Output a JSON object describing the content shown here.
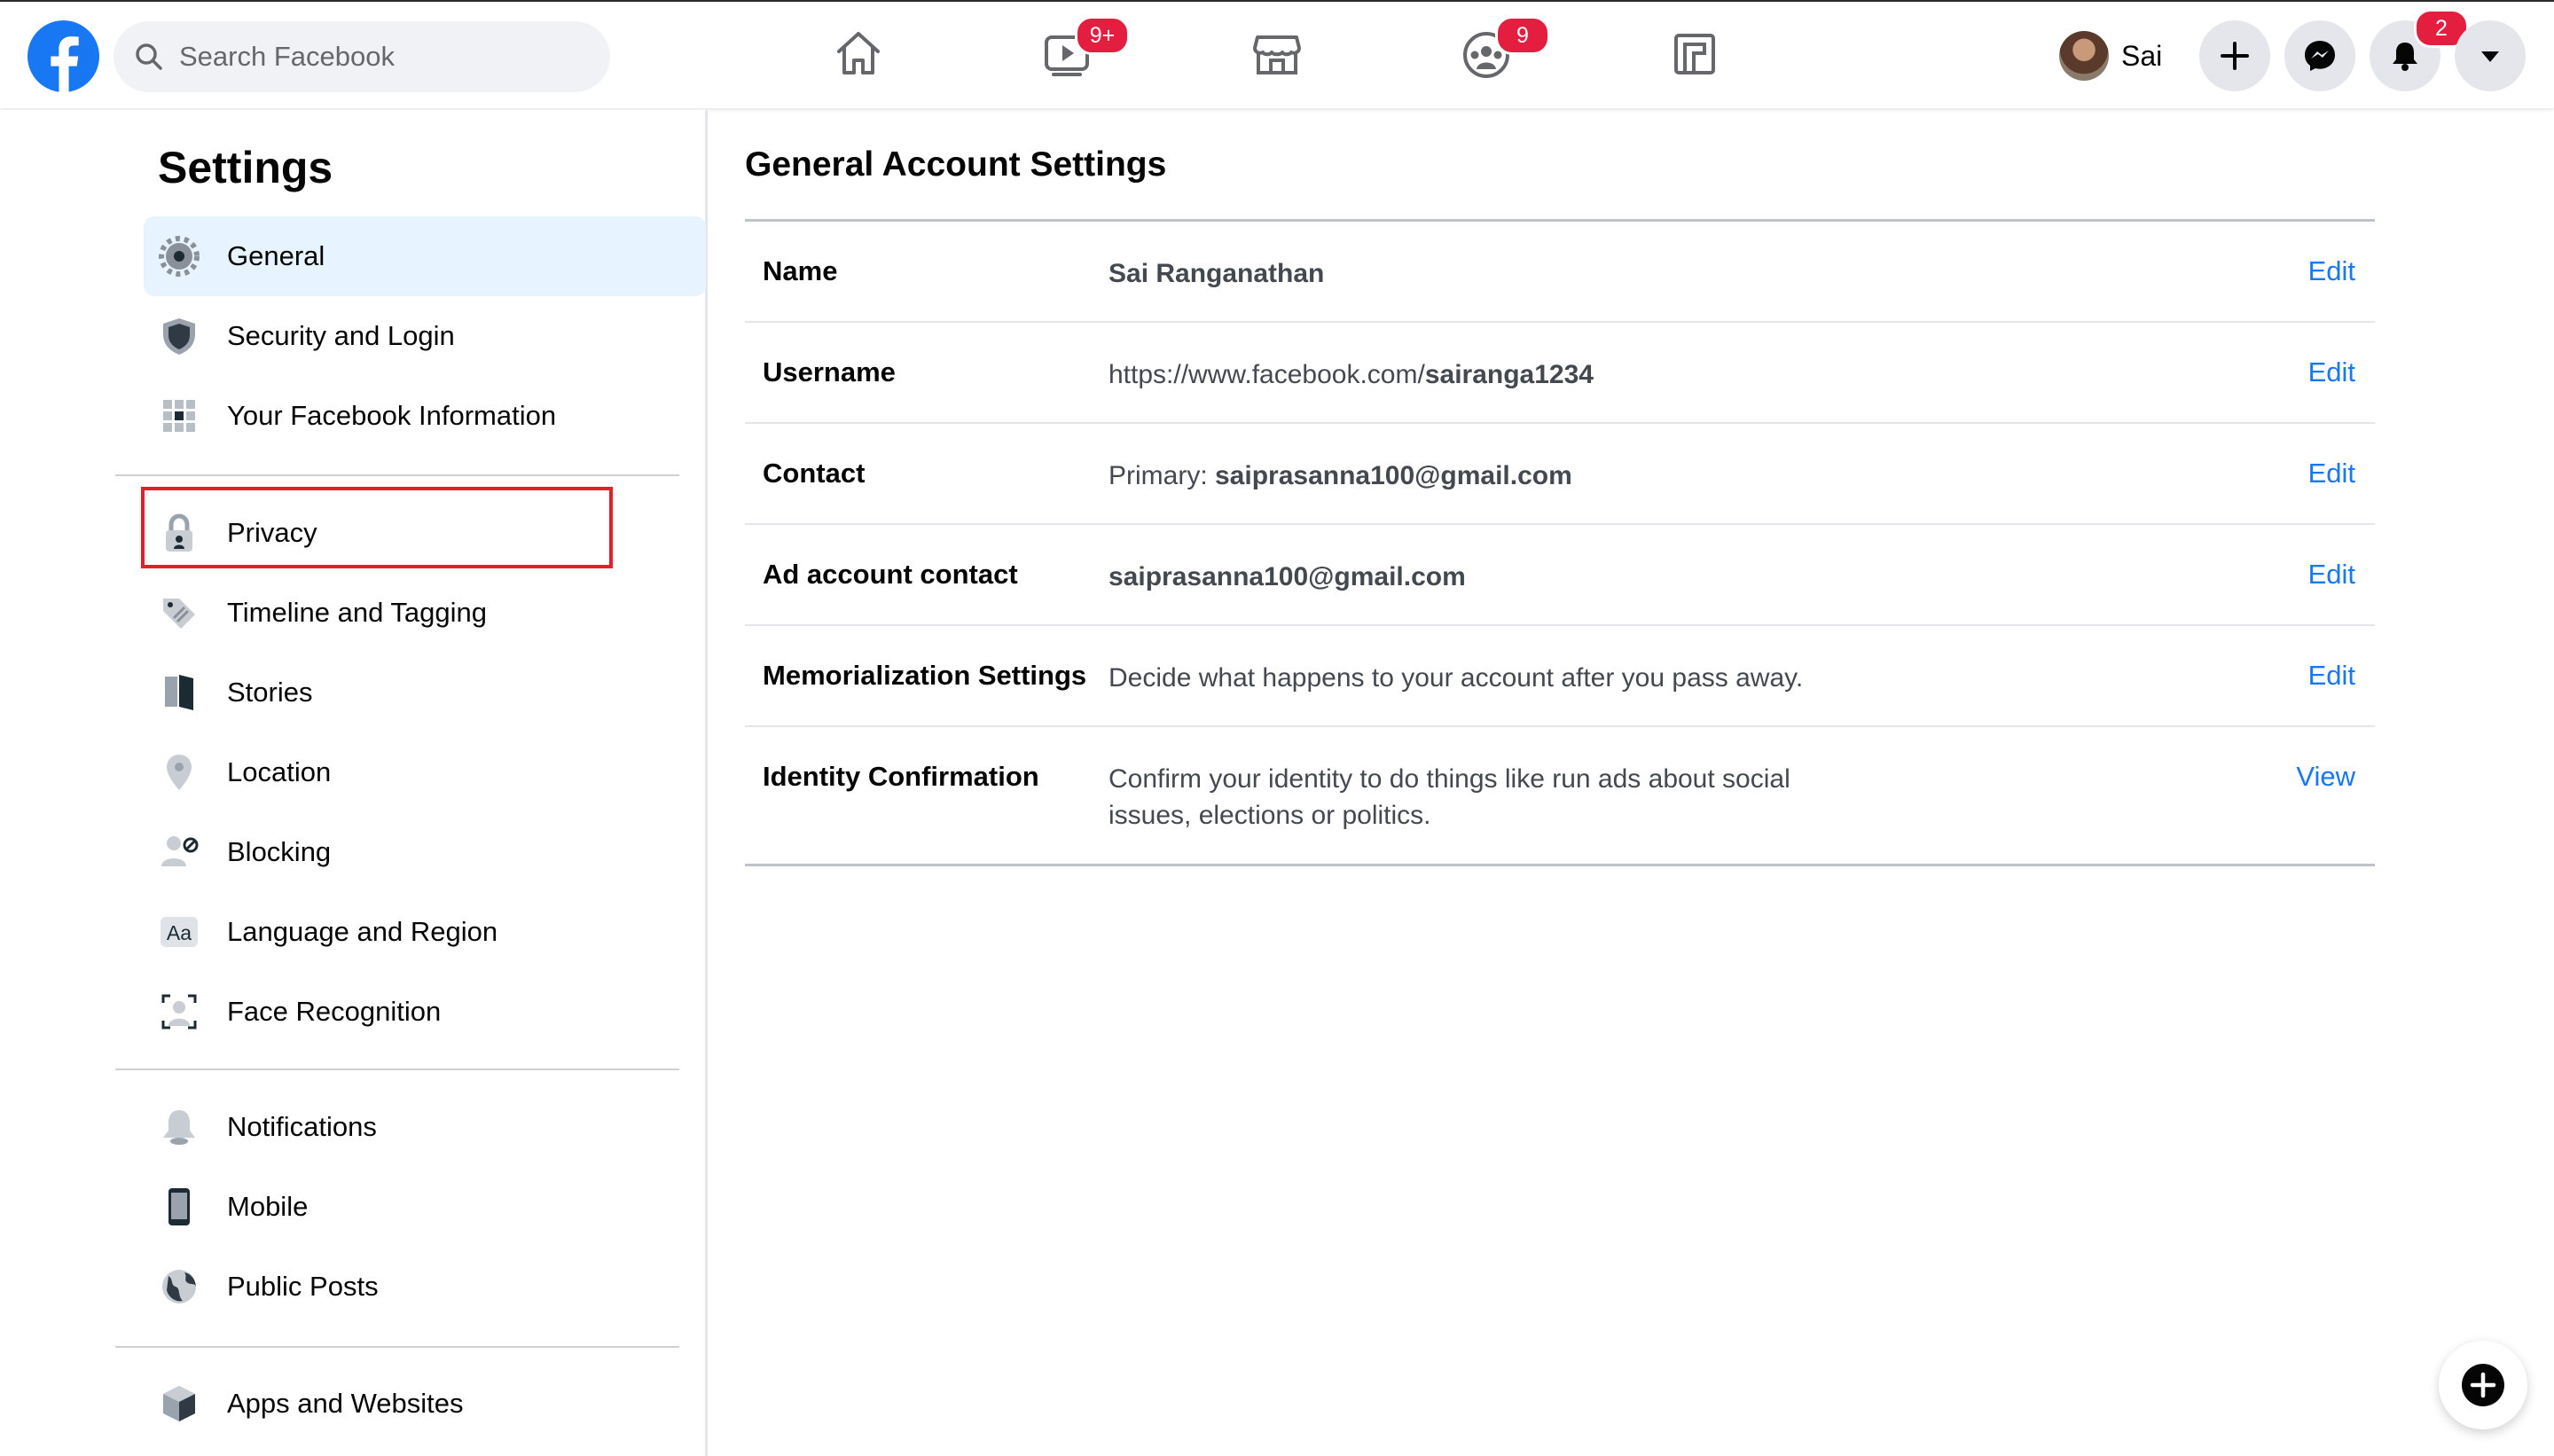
{
  "topbar": {
    "search_placeholder": "Search Facebook",
    "watch_badge": "9+",
    "groups_badge": "9",
    "notifications_badge": "2",
    "profile_name": "Sai",
    "icons": [
      "facebook-logo-icon",
      "home-icon",
      "watch-icon",
      "marketplace-icon",
      "groups-icon",
      "gaming-icon",
      "plus-icon",
      "messenger-icon",
      "bell-icon",
      "caret-down-icon"
    ]
  },
  "sidebar": {
    "title": "Settings",
    "items": [
      {
        "label": "General",
        "icon": "gear-icon",
        "active": true
      },
      {
        "label": "Security and Login",
        "icon": "shield-icon"
      },
      {
        "label": "Your Facebook Information",
        "icon": "grid-icon"
      },
      {
        "label": "Privacy",
        "icon": "lock-icon"
      },
      {
        "label": "Timeline and Tagging",
        "icon": "tag-icon"
      },
      {
        "label": "Stories",
        "icon": "book-icon"
      },
      {
        "label": "Location",
        "icon": "location-pin-icon"
      },
      {
        "label": "Blocking",
        "icon": "block-user-icon"
      },
      {
        "label": "Language and Region",
        "icon": "language-icon"
      },
      {
        "label": "Face Recognition",
        "icon": "face-scan-icon"
      },
      {
        "label": "Notifications",
        "icon": "bell-icon"
      },
      {
        "label": "Mobile",
        "icon": "mobile-icon"
      },
      {
        "label": "Public Posts",
        "icon": "globe-icon"
      },
      {
        "label": "Apps and Websites",
        "icon": "cube-icon"
      }
    ]
  },
  "main": {
    "title": "General Account Settings",
    "rows": [
      {
        "label": "Name",
        "value": "Sai Ranganathan",
        "action": "Edit"
      },
      {
        "label": "Username",
        "value_prefix": "https://www.facebook.com/",
        "value_bold": "sairanga1234",
        "action": "Edit"
      },
      {
        "label": "Contact",
        "value_prefix": "Primary: ",
        "value_bold": "saiprasanna100@gmail.com",
        "action": "Edit"
      },
      {
        "label": "Ad account contact",
        "value_bold": "saiprasanna100@gmail.com",
        "action": "Edit"
      },
      {
        "label": "Memorialization Settings",
        "value": "Decide what happens to your account after you pass away.",
        "action": "Edit"
      },
      {
        "label": "Identity Confirmation",
        "value_line1": "Confirm your identity to do things like run ads about social",
        "value_line2": "issues, elections or politics.",
        "action": "View"
      }
    ]
  },
  "colors": {
    "brand": "#1877f2",
    "badge": "#e41e3f",
    "active_bg": "#e7f3ff",
    "highlight": "#e0202a"
  }
}
